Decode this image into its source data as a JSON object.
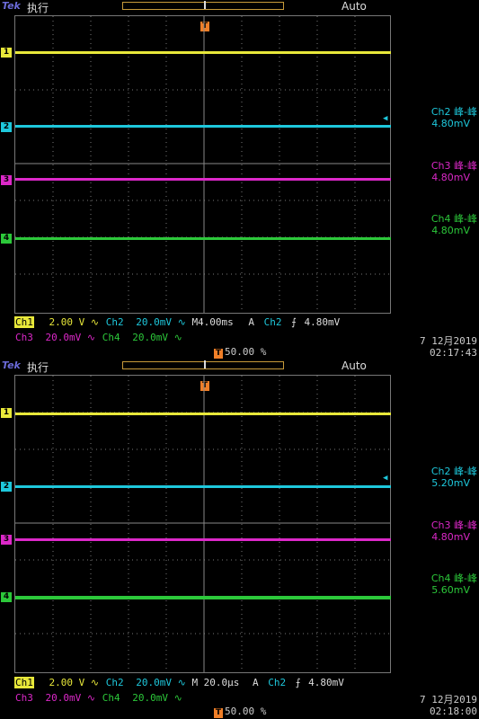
{
  "colors": {
    "ch1": "#e8e83a",
    "ch2": "#1ec8dc",
    "ch3": "#dc28c8",
    "ch4": "#2cc83a",
    "trigger": "#f07f28",
    "brand": "#6a6ad8"
  },
  "screens": [
    {
      "brand": "Tek",
      "state": "执行",
      "mode": "Auto",
      "meas": [
        {
          "label": "Ch2 峰-峰",
          "value": "4.80mV"
        },
        {
          "label": "Ch3 峰-峰",
          "value": "4.80mV"
        },
        {
          "label": "Ch4 峰-峰",
          "value": "4.80mV"
        }
      ],
      "row1": {
        "ch1": "Ch1",
        "ch1_scale": "2.00 V",
        "ch2": "Ch2",
        "ch2_scale": "20.0mV",
        "timebase": "M4.00ms",
        "trig_mode": "A",
        "trig_src": "Ch2",
        "trig_level": "4.80mV"
      },
      "row2": {
        "ch3": "Ch3",
        "ch3_scale": "20.0mV",
        "ch4": "Ch4",
        "ch4_scale": "20.0mV"
      },
      "trig_pos": "50.00 %",
      "date": "7 12月2019",
      "time": "02:17:43"
    },
    {
      "brand": "Tek",
      "state": "执行",
      "mode": "Auto",
      "meas": [
        {
          "label": "Ch2 峰-峰",
          "value": "5.20mV"
        },
        {
          "label": "Ch3 峰-峰",
          "value": "4.80mV"
        },
        {
          "label": "Ch4 峰-峰",
          "value": "5.60mV"
        }
      ],
      "row1": {
        "ch1": "Ch1",
        "ch1_scale": "2.00 V",
        "ch2": "Ch2",
        "ch2_scale": "20.0mV",
        "timebase": "M 20.0µs",
        "trig_mode": "A",
        "trig_src": "Ch2",
        "trig_level": "4.80mV"
      },
      "row2": {
        "ch3": "Ch3",
        "ch3_scale": "20.0mV",
        "ch4": "Ch4",
        "ch4_scale": "20.0mV"
      },
      "trig_pos": "50.00 %",
      "date": "7 12月2019",
      "time": "02:18:00"
    }
  ],
  "markers": {
    "ch1": "1",
    "ch2": "2",
    "ch3": "3",
    "ch4": "4",
    "trigger": "T"
  }
}
